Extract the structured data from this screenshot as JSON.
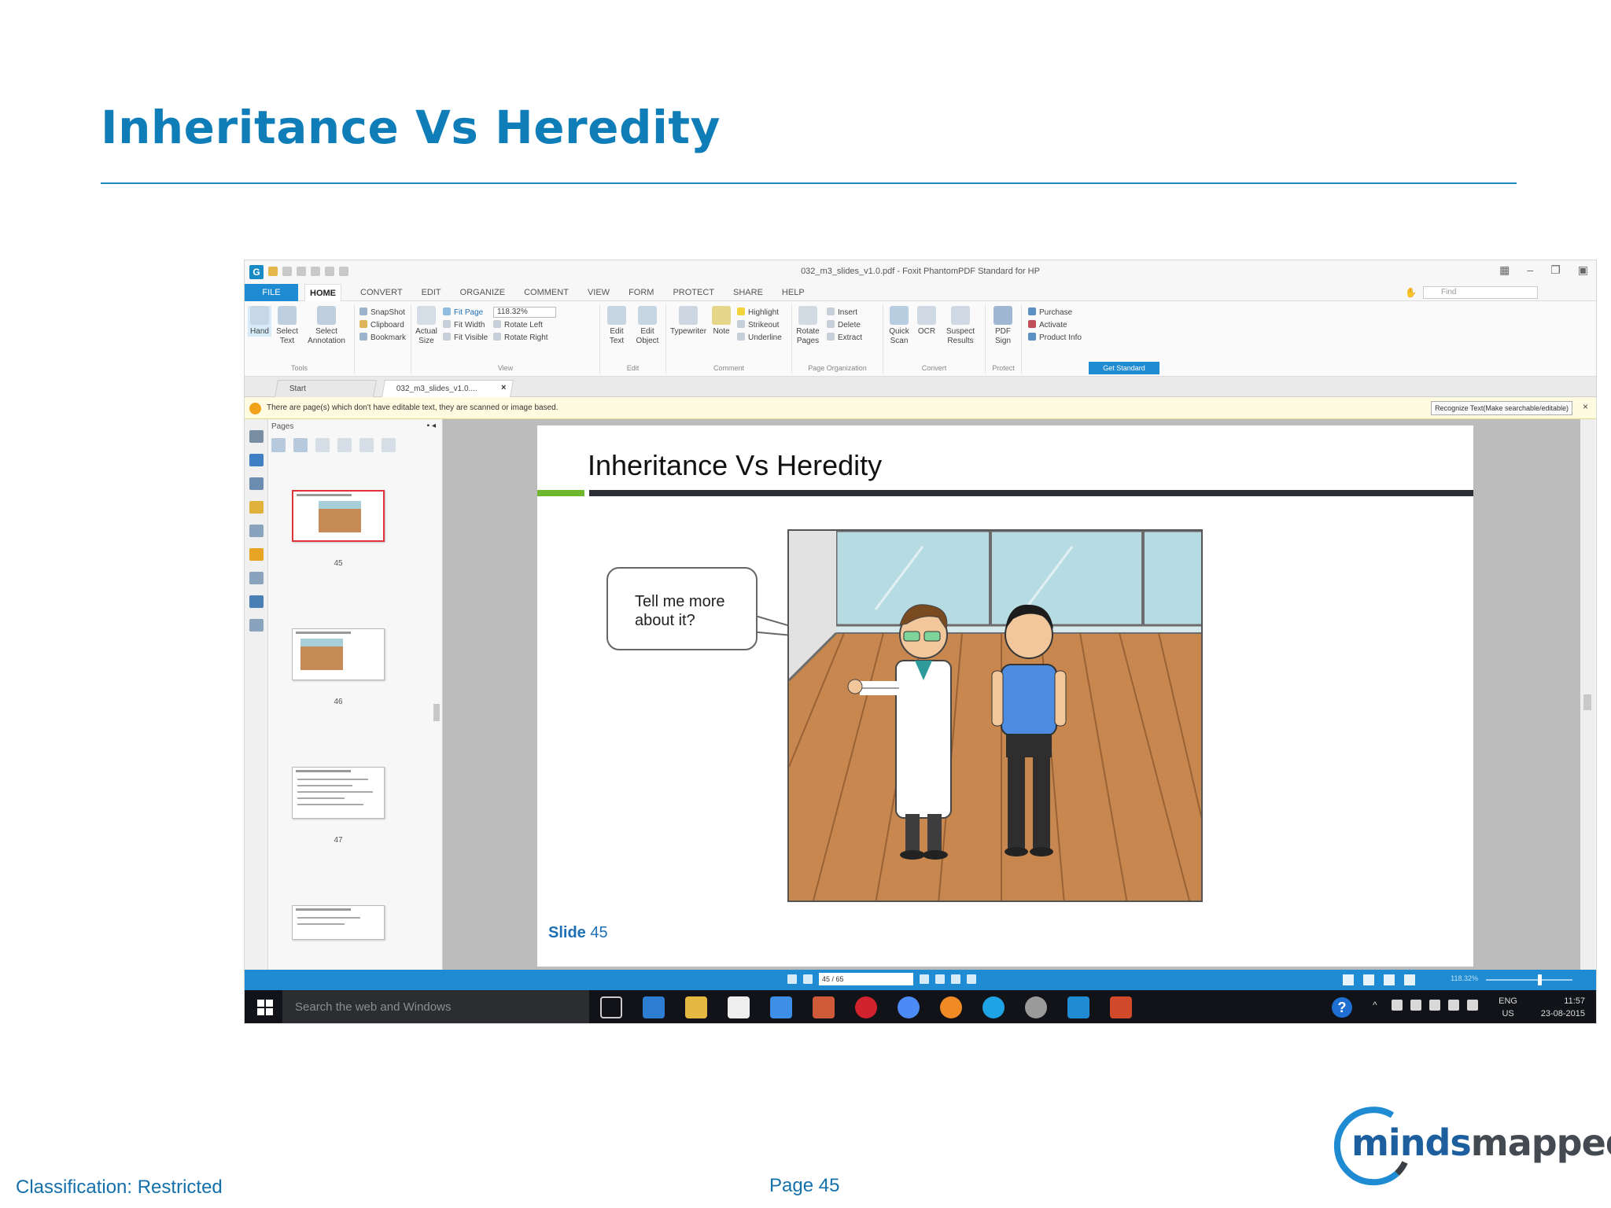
{
  "slide": {
    "title": "Inheritance Vs Heredity",
    "footer_classification": "Classification: Restricted",
    "footer_page": "Page 45",
    "logo_text_left": "minds",
    "logo_text_right": "mapped",
    "accent_color": "#0f7db8"
  },
  "app": {
    "window_title": "032_m3_slides_v1.0.pdf - Foxit PhantomPDF Standard for HP",
    "menu": {
      "file": "FILE",
      "items": [
        "HOME",
        "CONVERT",
        "EDIT",
        "ORGANIZE",
        "COMMENT",
        "VIEW",
        "FORM",
        "PROTECT",
        "SHARE",
        "HELP"
      ],
      "find_placeholder": "Find"
    },
    "ribbon": {
      "tools": {
        "hand": "Hand",
        "select_text": "Select Text",
        "select_annotation": "Select Annotation",
        "snapshot": "SnapShot",
        "clipboard": "Clipboard",
        "bookmark": "Bookmark",
        "label": "Tools"
      },
      "view": {
        "actual_size": "Actual Size",
        "fit_page": "Fit Page",
        "fit_width": "Fit Width",
        "fit_visible": "Fit Visible",
        "zoom": "118.32%",
        "rotate_left": "Rotate Left",
        "rotate_right": "Rotate Right",
        "label": "View"
      },
      "edit": {
        "edit_text": "Edit Text",
        "edit_object": "Edit Object",
        "label": "Edit"
      },
      "comment": {
        "typewriter": "Typewriter",
        "note": "Note",
        "highlight": "Highlight",
        "strikeout": "Strikeout",
        "underline": "Underline",
        "label": "Comment"
      },
      "page_org": {
        "rotate_pages": "Rotate Pages",
        "insert": "Insert",
        "delete": "Delete",
        "extract": "Extract",
        "label": "Page Organization"
      },
      "convert": {
        "quick_scan": "Quick Scan",
        "ocr": "OCR",
        "suspect_results": "Suspect Results",
        "label": "Convert"
      },
      "protect": {
        "pdf_sign": "PDF Sign",
        "label": "Protect"
      },
      "help": {
        "purchase": "Purchase",
        "activate": "Activate",
        "product_info": "Product Info",
        "get_standard": "Get Standard"
      }
    },
    "tabs": [
      "Start",
      "032_m3_slides_v1.0...."
    ],
    "notice": {
      "text": "There are page(s) which don't have editable text, they are scanned or image based.",
      "button": "Recognize Text(Make searchable/editable)"
    },
    "pages_panel": {
      "label": "Pages",
      "page_numbers": [
        "45",
        "46",
        "47"
      ]
    },
    "document": {
      "page_title": "Inheritance Vs Heredity",
      "bubble_text_1": "Tell me more",
      "bubble_text_2": "about it?",
      "slide_label": "Slide",
      "slide_number": "45"
    },
    "status": {
      "page_field": "45 / 65",
      "zoom": "118.32%"
    },
    "taskbar": {
      "search_placeholder": "Search the web and Windows",
      "lang_top": "ENG",
      "lang_bottom": "US",
      "time": "11:57",
      "date": "23-08-2015"
    }
  }
}
